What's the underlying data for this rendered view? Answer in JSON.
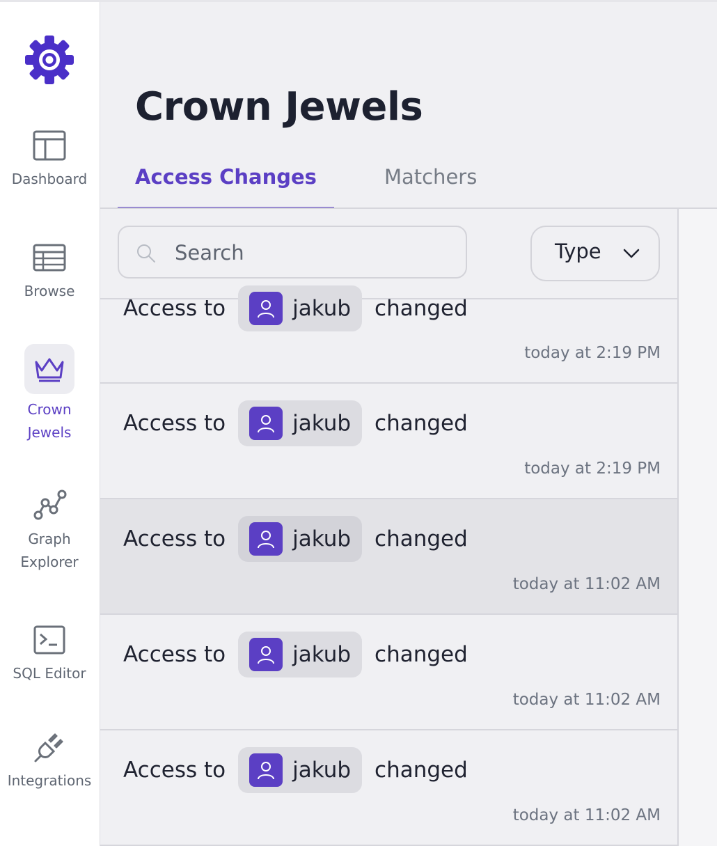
{
  "sidebar": {
    "items": [
      {
        "label": "Dashboard",
        "icon": "dashboard-icon"
      },
      {
        "label": "Browse",
        "icon": "table-icon"
      },
      {
        "label": "Crown Jewels",
        "icon": "crown-icon",
        "active": true
      },
      {
        "label": "Graph Explorer",
        "icon": "graph-icon"
      },
      {
        "label": "SQL Editor",
        "icon": "terminal-icon"
      },
      {
        "label": "Integrations",
        "icon": "plug-icon"
      }
    ]
  },
  "header": {
    "title": "Crown Jewels"
  },
  "tabs": [
    {
      "label": "Access Changes",
      "active": true
    },
    {
      "label": "Matchers"
    }
  ],
  "filters": {
    "search_placeholder": "Search",
    "type_label": "Type"
  },
  "rows": [
    {
      "prefix": "Access to",
      "user": "jakub",
      "suffix": "changed",
      "time": "today at 2:19 PM"
    },
    {
      "prefix": "Access to",
      "user": "jakub",
      "suffix": "changed",
      "time": "today at 2:19 PM"
    },
    {
      "prefix": "Access to",
      "user": "jakub",
      "suffix": "changed",
      "time": "today at 11:02 AM"
    },
    {
      "prefix": "Access to",
      "user": "jakub",
      "suffix": "changed",
      "time": "today at 11:02 AM"
    },
    {
      "prefix": "Access to",
      "user": "jakub",
      "suffix": "changed",
      "time": "today at 11:02 AM"
    }
  ],
  "colors": {
    "accent": "#5b3fc4",
    "background": "#f0f0f3",
    "muted_text": "#6c7380"
  }
}
